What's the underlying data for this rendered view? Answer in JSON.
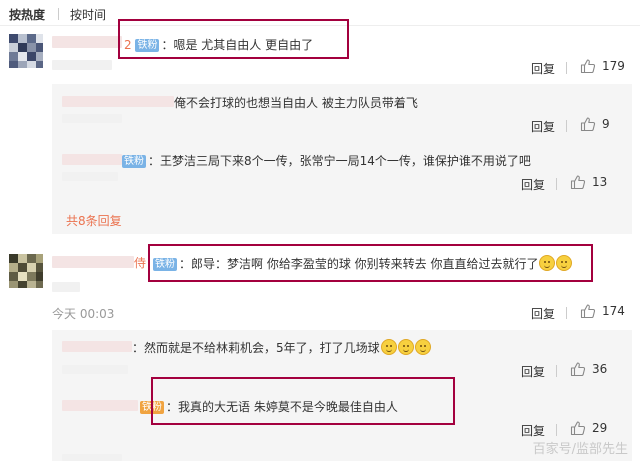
{
  "sort": {
    "hot_label": "按热度",
    "time_label": "按时间"
  },
  "comments": [
    {
      "fan_num": "2",
      "fan_badge": "铁粉",
      "text": "：嗯是 尤其自由人 更自由了",
      "reply_label": "回复",
      "likes": "179",
      "replies": [
        {
          "text": "俺不会打球的也想当自由人 被主力队员带着飞",
          "reply_label": "回复",
          "likes": "9"
        },
        {
          "fan_badge": "铁粉",
          "text": "：王梦洁三局下来8个一传，张常宁一局14个一传，谁保护谁不用说了吧",
          "reply_label": "回复",
          "likes": "13"
        }
      ],
      "more_label": "共8条回复"
    },
    {
      "name_tail": "侍",
      "fan_badge": "铁粉",
      "text": "：郎导：梦洁啊 你给李盈莹的球 你别转来转去 你直直给过去就行了",
      "time": "今天 00:03",
      "reply_label": "回复",
      "likes": "174",
      "replies": [
        {
          "text": "：然而就是不给林莉机会，5年了，打了几场球",
          "reply_label": "回复",
          "likes": "36"
        },
        {
          "fan_badge": "铁粉",
          "text": "：我真的大无语 朱婷莫不是今晚最佳自由人",
          "reply_label": "回复",
          "likes": "29"
        }
      ]
    }
  ],
  "watermark": "百家号/监部先生",
  "colors": {
    "accent": "#eb7350",
    "highlight_box": "#a3003e",
    "badge": "#7ab3e6"
  }
}
